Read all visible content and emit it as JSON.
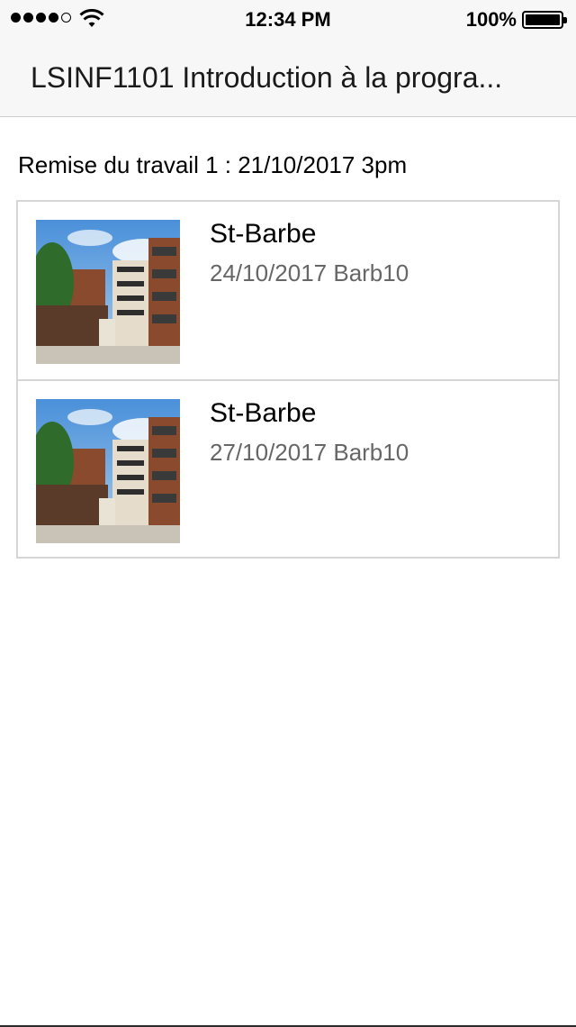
{
  "status_bar": {
    "time": "12:34 PM",
    "battery_percent": "100%",
    "signal_bars_filled": 4,
    "signal_bars_total": 5,
    "icons": [
      "signal-dots-icon",
      "wifi-icon",
      "battery-icon"
    ]
  },
  "nav": {
    "title": "LSINF1101 Introduction à la progra..."
  },
  "section": {
    "header": "Remise du travail 1 : 21/10/2017 3pm"
  },
  "rows": [
    {
      "title": "St-Barbe",
      "subtitle": "24/10/2017 Barb10",
      "image": "building-photo"
    },
    {
      "title": "St-Barbe",
      "subtitle": "27/10/2017 Barb10",
      "image": "building-photo"
    }
  ],
  "colors": {
    "bar_background": "#f7f7f7",
    "separator": "#d6d6d6",
    "subtitle": "#666666"
  }
}
